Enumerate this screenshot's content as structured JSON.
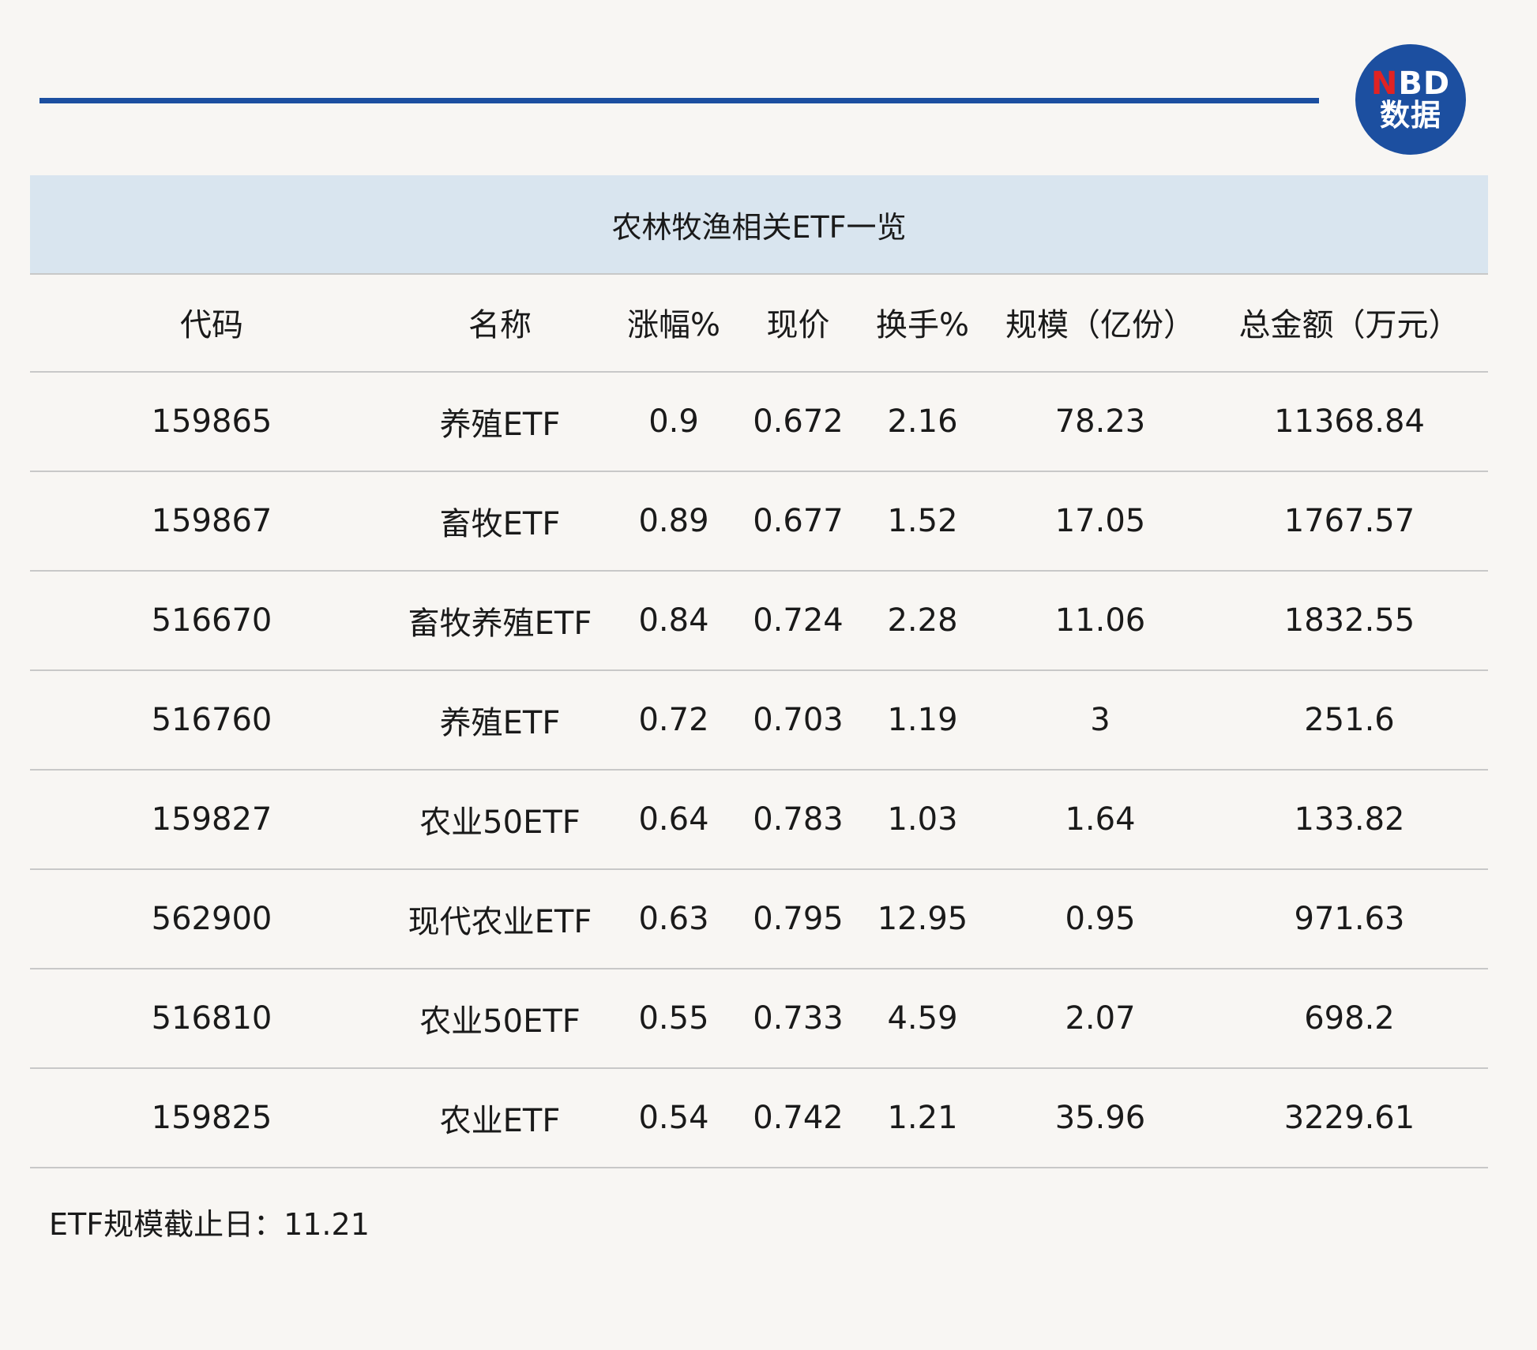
{
  "logo": {
    "line1_n": "N",
    "line1_rest": "BD",
    "line2": "数据"
  },
  "title": "农林牧渔相关ETF一览",
  "columns": [
    "代码",
    "名称",
    "涨幅%",
    "现价",
    "换手%",
    "规模（亿份）",
    "总金额（万元）"
  ],
  "rows": [
    [
      "159865",
      "养殖ETF",
      "0.9",
      "0.672",
      "2.16",
      "78.23",
      "11368.84"
    ],
    [
      "159867",
      "畜牧ETF",
      "0.89",
      "0.677",
      "1.52",
      "17.05",
      "1767.57"
    ],
    [
      "516670",
      "畜牧养殖ETF",
      "0.84",
      "0.724",
      "2.28",
      "11.06",
      "1832.55"
    ],
    [
      "516760",
      "养殖ETF",
      "0.72",
      "0.703",
      "1.19",
      "3",
      "251.6"
    ],
    [
      "159827",
      "农业50ETF",
      "0.64",
      "0.783",
      "1.03",
      "1.64",
      "133.82"
    ],
    [
      "562900",
      "现代农业ETF",
      "0.63",
      "0.795",
      "12.95",
      "0.95",
      "971.63"
    ],
    [
      "516810",
      "农业50ETF",
      "0.55",
      "0.733",
      "4.59",
      "2.07",
      "698.2"
    ],
    [
      "159825",
      "农业ETF",
      "0.54",
      "0.742",
      "1.21",
      "35.96",
      "3229.61"
    ]
  ],
  "footnote": "ETF规模截止日：11.21"
}
